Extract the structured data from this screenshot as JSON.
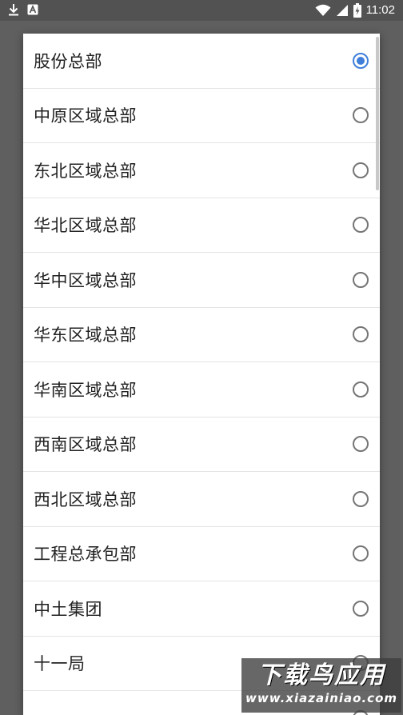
{
  "status_bar": {
    "time": "11:02",
    "icons": [
      "download-icon",
      "a-notification-icon",
      "wifi-icon",
      "cell-signal-icon",
      "battery-charging-icon"
    ]
  },
  "dialog": {
    "items": [
      {
        "label": "股份总部",
        "checked": true
      },
      {
        "label": "中原区域总部",
        "checked": false
      },
      {
        "label": "东北区域总部",
        "checked": false
      },
      {
        "label": "华北区域总部",
        "checked": false
      },
      {
        "label": "华中区域总部",
        "checked": false
      },
      {
        "label": "华东区域总部",
        "checked": false
      },
      {
        "label": "华南区域总部",
        "checked": false
      },
      {
        "label": "西南区域总部",
        "checked": false
      },
      {
        "label": "西北区域总部",
        "checked": false
      },
      {
        "label": "工程总承包部",
        "checked": false
      },
      {
        "label": "中土集团",
        "checked": false
      },
      {
        "label": "十一局",
        "checked": false
      },
      {
        "label": "",
        "checked": false
      }
    ]
  },
  "watermark": {
    "title": "下载鸟应用",
    "url": "www.xiazainiao.com"
  },
  "colors": {
    "accent": "#3f7fd9",
    "scrim": "#5f5f5f",
    "dialog_bg": "#ffffff"
  }
}
